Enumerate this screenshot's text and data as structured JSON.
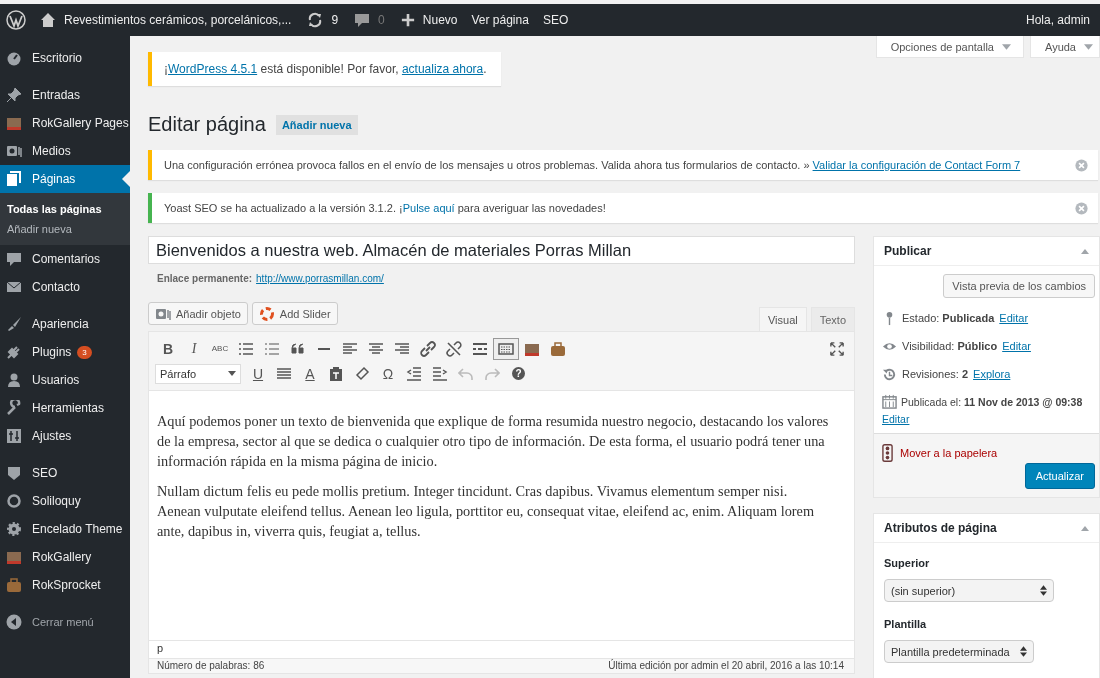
{
  "admin_bar": {
    "site_name": "Revestimientos cerámicos, porcelánicos,...",
    "updates": "9",
    "comments": "0",
    "new_label": "Nuevo",
    "view_label": "Ver página",
    "seo_label": "SEO",
    "greeting": "Hola, admin"
  },
  "sidebar": {
    "groups": [
      [
        {
          "label": "Escritorio",
          "selected": false
        }
      ],
      [
        {
          "label": "Entradas",
          "selected": false
        },
        {
          "label": "RokGallery Pages",
          "selected": false
        },
        {
          "label": "Medios",
          "selected": false
        },
        {
          "label": "Páginas",
          "selected": true,
          "children": [
            {
              "label": "Todas las páginas",
              "selected": true
            },
            {
              "label": "Añadir nueva",
              "selected": false
            }
          ]
        },
        {
          "label": "Comentarios",
          "selected": false
        },
        {
          "label": "Contacto",
          "selected": false
        }
      ],
      [
        {
          "label": "Apariencia",
          "selected": false
        },
        {
          "label": "Plugins",
          "selected": false,
          "badge": "3"
        },
        {
          "label": "Usuarios",
          "selected": false
        },
        {
          "label": "Herramientas",
          "selected": false
        },
        {
          "label": "Ajustes",
          "selected": false
        }
      ],
      [
        {
          "label": "SEO",
          "selected": false
        },
        {
          "label": "Soliloquy",
          "selected": false
        },
        {
          "label": "Encelado Theme",
          "selected": false
        },
        {
          "label": "RokGallery",
          "selected": false
        },
        {
          "label": "RokSprocket",
          "selected": false
        }
      ]
    ],
    "collapse_label": "Cerrar menú"
  },
  "screen_tabs": [
    "Opciones de pantalla",
    "Ayuda"
  ],
  "update_notice": {
    "color": "#ffb900",
    "parts": [
      {
        "kind": "text",
        "text": "¡"
      },
      {
        "kind": "link",
        "text": "WordPress 4.5.1"
      },
      {
        "kind": "text",
        "text": " está disponible! Por favor, "
      },
      {
        "kind": "link",
        "text": "actualiza ahora"
      },
      {
        "kind": "text",
        "text": "."
      }
    ]
  },
  "heading": "Editar página",
  "add_new": "Añadir nueva",
  "notices": [
    {
      "color": "#ffb900",
      "parts": [
        {
          "kind": "text",
          "text": "Una configuración errónea provoca fallos en el envío de los mensajes u otros problemas. Valida ahora tus formularios de contacto. » "
        },
        {
          "kind": "link",
          "text": "Validar la configuración de Contact Form 7"
        }
      ]
    },
    {
      "color": "#46b450",
      "parts": [
        {
          "kind": "text",
          "text": "Yoast SEO se ha actualizado a la versión 3.1.2. ¡"
        },
        {
          "kind": "plainlink",
          "text": "Pulse aquí"
        },
        {
          "kind": "text",
          "text": " para averiguar las novedades!"
        }
      ]
    }
  ],
  "editor": {
    "title": "Bienvenidos a nuestra web. Almacén de materiales Porras Millan",
    "permalink_label": "Enlace permanente:",
    "permalink": "http://www.porrasmillan.com/",
    "media_buttons": [
      "Añadir objeto",
      "Add Slider"
    ],
    "tabs": [
      {
        "label": "Visual",
        "selected": true
      },
      {
        "label": "Texto",
        "selected": false
      }
    ],
    "toolbar_rows": [
      [
        {
          "kind": "bold",
          "label": "B",
          "pressed": false
        },
        {
          "kind": "italic",
          "label": "I",
          "pressed": false
        },
        {
          "kind": "strike",
          "label": "ABC",
          "pressed": false
        },
        {
          "kind": "bullets",
          "pressed": false
        },
        {
          "kind": "numbers",
          "pressed": false
        },
        {
          "kind": "quote",
          "pressed": false
        },
        {
          "kind": "hr",
          "pressed": false
        },
        {
          "kind": "alignleft",
          "pressed": false
        },
        {
          "kind": "aligncenter",
          "pressed": false
        },
        {
          "kind": "alignright",
          "pressed": false
        },
        {
          "kind": "link",
          "pressed": false
        },
        {
          "kind": "unlink",
          "pressed": false
        },
        {
          "kind": "more",
          "pressed": false
        },
        {
          "kind": "toggle",
          "pressed": true
        },
        {
          "kind": "gallery",
          "pressed": false
        },
        {
          "kind": "toolbox",
          "pressed": false
        }
      ],
      [
        {
          "kind": "underline",
          "label": "U",
          "disabled": false
        },
        {
          "kind": "justify",
          "disabled": false
        },
        {
          "kind": "color",
          "label": "A",
          "disabled": false
        },
        {
          "kind": "paste",
          "disabled": false
        },
        {
          "kind": "eraser",
          "disabled": false
        },
        {
          "kind": "omega",
          "label": "Ω",
          "disabled": false
        },
        {
          "kind": "outdent",
          "disabled": false
        },
        {
          "kind": "indent",
          "disabled": false
        },
        {
          "kind": "undo",
          "disabled": true
        },
        {
          "kind": "redo",
          "disabled": true
        },
        {
          "kind": "help",
          "label": "?",
          "disabled": false
        }
      ]
    ],
    "format": "Párrafo",
    "paragraphs": [
      "Aquí podemos poner un texto de bienvenida que explique de forma resumida nuestro negocio, destacando los valores de la empresa, sector al que se dedica o cualquier otro tipo de información. De esta forma, el usuario podrá tener una información rápida en la misma página de inicio.",
      "Nullam dictum felis eu pede mollis pretium. Integer tincidunt. Cras dapibus. Vivamus elementum semper nisi. Aenean vulputate eleifend tellus. Aenean leo ligula, porttitor eu, consequat vitae, eleifend ac, enim. Aliquam lorem ante, dapibus in, viverra quis, feugiat a, tellus."
    ],
    "path": "p",
    "word_count": "Número de palabras: 86",
    "last_edit": "Última edición por admin el 20 abril, 2016 a las 10:14"
  },
  "publish": {
    "title": "Publicar",
    "preview": "Vista previa de los cambios",
    "rows": [
      {
        "kind": "status",
        "text": "Estado: **Publicada**",
        "link": "Editar"
      },
      {
        "kind": "visibility",
        "text": "Visibilidad: **Público**",
        "link": "Editar"
      },
      {
        "kind": "revisions",
        "text": "Revisiones: **2**",
        "link": "Explora"
      },
      {
        "kind": "date",
        "text": "Publicada el: **11 Nov de 2013 @ 09:38**",
        "link": "Editar"
      }
    ],
    "trash": "Mover a la papelera",
    "update": "Actualizar"
  },
  "attributes": {
    "title": "Atributos de página",
    "parent_label": "Superior",
    "parent_value": "(sin superior)",
    "template_label": "Plantilla",
    "template_value": "Plantilla predeterminada"
  }
}
